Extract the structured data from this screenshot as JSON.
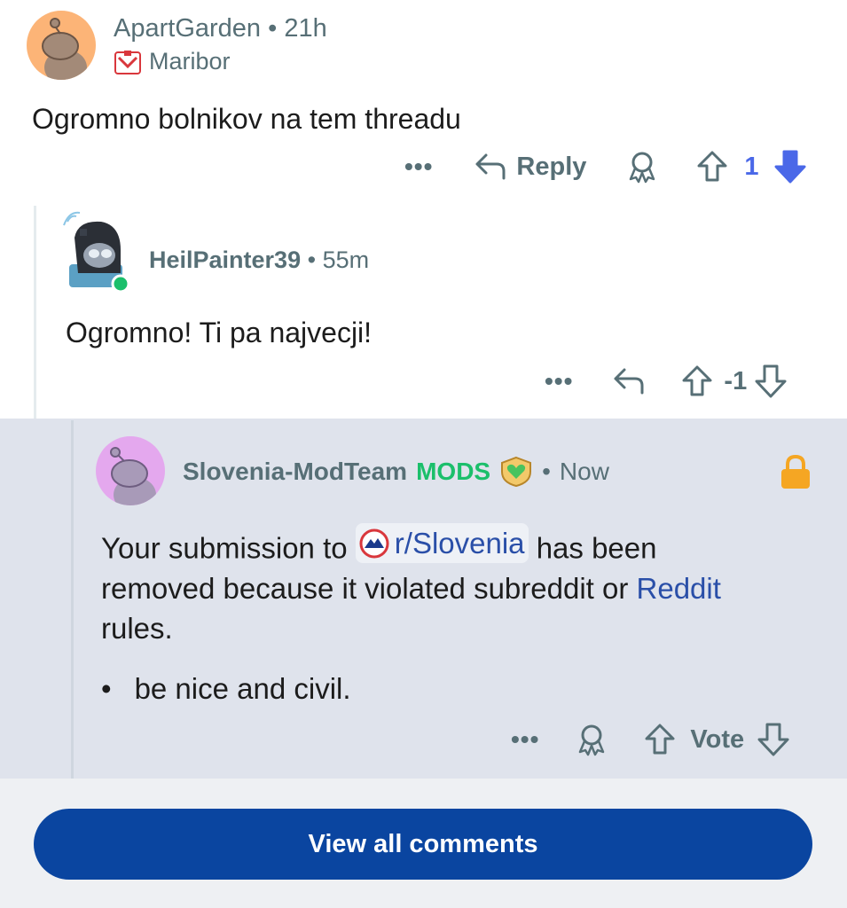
{
  "comment1": {
    "username": "ApartGarden",
    "separator": "•",
    "time": "21h",
    "flair": "Maribor",
    "body": "Ogromno bolnikov na tem threadu",
    "more": "•••",
    "reply_label": "Reply",
    "vote_count": "1"
  },
  "comment2": {
    "username": "HeilPainter39",
    "separator": "•",
    "time": "55m",
    "body": "Ogromno! Ti pa najvecji!",
    "more": "•••",
    "vote_count": "-1"
  },
  "comment3": {
    "username": "Slovenia-ModTeam",
    "badge": "MODS",
    "separator": "•",
    "time": "Now",
    "body_part1": "Your submission to",
    "subreddit": "r/Slovenia",
    "body_part2": "has been removed because it violated subreddit or",
    "reddit_link": "Reddit",
    "body_part3": "rules.",
    "bullet_symbol": "•",
    "bullet_text": "be nice and civil.",
    "more": "•••",
    "vote_label": "Vote"
  },
  "footer": {
    "view_all_label": "View all comments"
  },
  "colors": {
    "upvoted_orange": "#fcb477",
    "downvote_blue": "#4a68e8",
    "mod_green": "#1bbf6b",
    "button_blue": "#0a45a0"
  }
}
